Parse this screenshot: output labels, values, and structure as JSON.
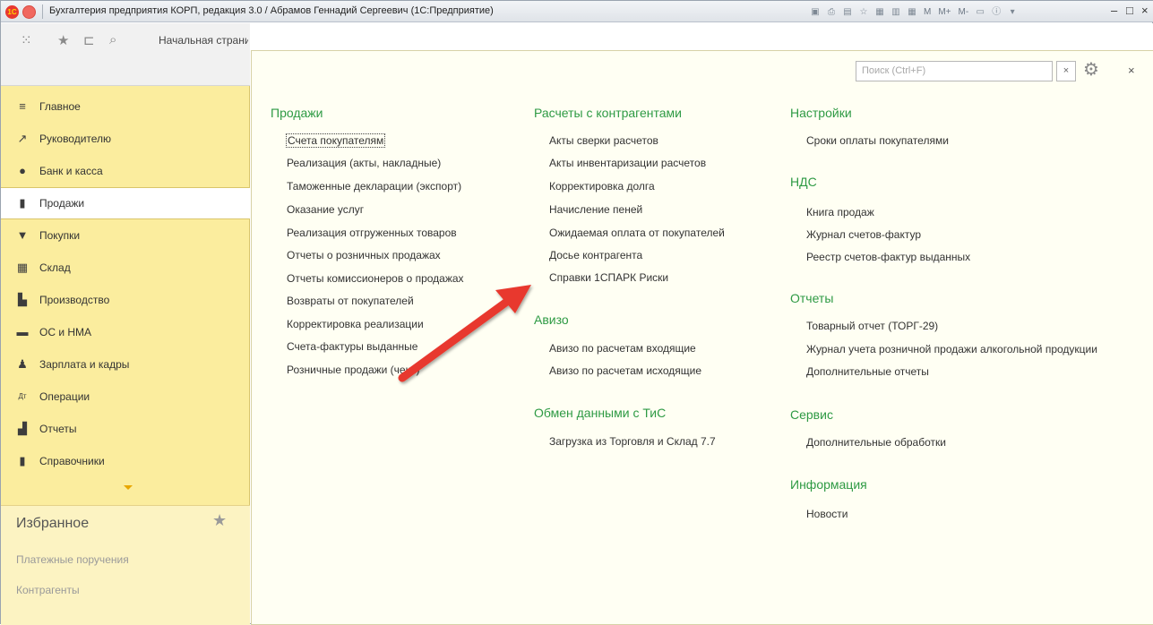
{
  "window": {
    "title": "Бухгалтерия предприятия КОРП, редакция 3.0 / Абрамов Геннадий Сергеевич  (1С:Предприятие)",
    "logo_text": "1С",
    "toolbar_m_buttons": [
      "M",
      "M+",
      "M-"
    ]
  },
  "topbar": {
    "start_tab": "Начальная страница"
  },
  "sidebar": {
    "items": [
      {
        "label": "Главное",
        "icon": "menu-lines-icon"
      },
      {
        "label": "Руководителю",
        "icon": "trend-chart-icon"
      },
      {
        "label": "Банк и касса",
        "icon": "bank-coin-icon"
      },
      {
        "label": "Продажи",
        "icon": "shopping-bag-icon"
      },
      {
        "label": "Покупки",
        "icon": "cart-icon"
      },
      {
        "label": "Склад",
        "icon": "warehouse-icon"
      },
      {
        "label": "Производство",
        "icon": "factory-icon"
      },
      {
        "label": "ОС и НМА",
        "icon": "truck-icon"
      },
      {
        "label": "Зарплата и кадры",
        "icon": "person-icon"
      },
      {
        "label": "Операции",
        "icon": "dt-kt-icon"
      },
      {
        "label": "Отчеты",
        "icon": "bar-chart-icon"
      },
      {
        "label": "Справочники",
        "icon": "books-icon"
      }
    ],
    "active_index": 3,
    "favorites": {
      "title": "Избранное",
      "items": [
        "Платежные поручения",
        "Контрагенты"
      ]
    }
  },
  "panel": {
    "search_placeholder": "Поиск (Ctrl+F)",
    "clear_label": "×",
    "close_label": "×",
    "columns": [
      {
        "groups": [
          {
            "title": "Продажи",
            "items": [
              "Счета покупателям",
              "Реализация (акты, накладные)",
              "Таможенные декларации (экспорт)",
              "Оказание услуг",
              "Реализация отгруженных товаров",
              "Отчеты о розничных продажах",
              "Отчеты комиссионеров о продажах",
              "Возвраты от покупателей",
              "Корректировка реализации",
              "Счета-фактуры выданные",
              "Розничные продажи (чеки)"
            ]
          }
        ]
      },
      {
        "groups": [
          {
            "title": "Расчеты с контрагентами",
            "items": [
              "Акты сверки расчетов",
              "Акты инвентаризации расчетов",
              "Корректировка долга",
              "Начисление пеней",
              "Ожидаемая оплата от покупателей",
              "Досье контрагента",
              "Справки 1СПАРК Риски"
            ]
          },
          {
            "title": "Авизо",
            "items": [
              "Авизо по расчетам входящие",
              "Авизо по расчетам исходящие"
            ]
          },
          {
            "title": "Обмен данными с ТиС",
            "items": [
              "Загрузка из Торговля и Склад 7.7"
            ]
          }
        ]
      },
      {
        "groups": [
          {
            "title": "Настройки",
            "items": [
              "Сроки оплаты покупателями"
            ]
          },
          {
            "title": "НДС",
            "items": [
              "Книга продаж",
              "Журнал счетов-фактур",
              "Реестр счетов-фактур выданных"
            ]
          },
          {
            "title": "Отчеты",
            "items": [
              "Товарный отчет (ТОРГ-29)",
              "Журнал учета розничной продажи алкогольной продукции",
              "Дополнительные отчеты"
            ]
          },
          {
            "title": "Сервис",
            "items": [
              "Дополнительные обработки"
            ]
          },
          {
            "title": "Информация",
            "items": [
              "Новости"
            ]
          }
        ]
      }
    ]
  },
  "colors": {
    "sidebar_bg": "#fbed9e",
    "group_title": "#2e9a44",
    "arrow": "#e8392e"
  }
}
